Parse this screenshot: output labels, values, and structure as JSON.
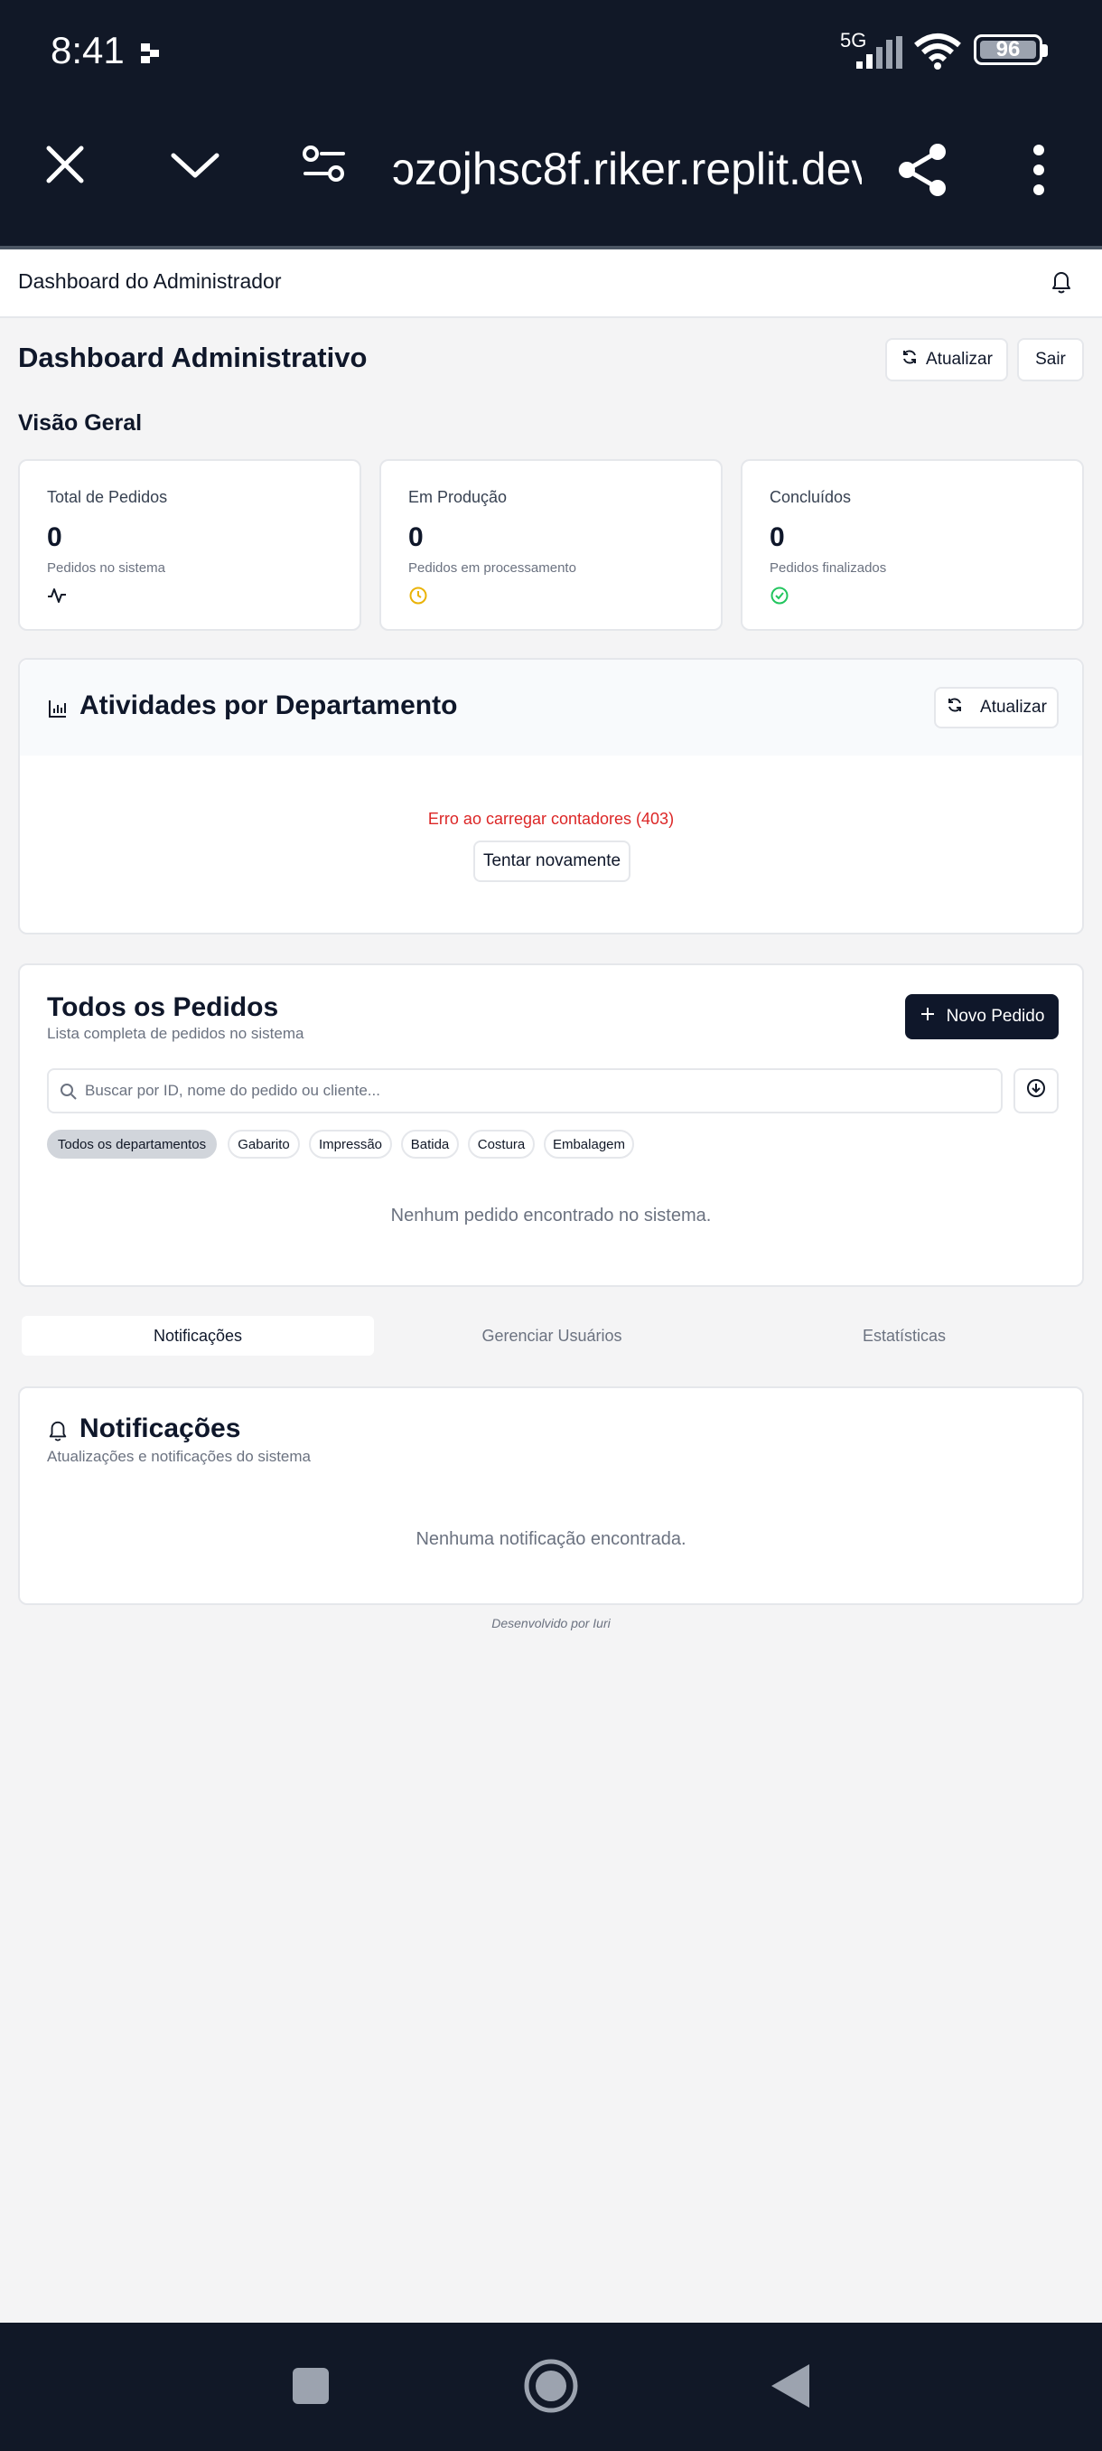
{
  "status_bar": {
    "time": "8:41",
    "network": "5G",
    "battery": "96",
    "icons": [
      "notification-icon",
      "signal-icon",
      "wifi-icon",
      "battery-icon"
    ]
  },
  "browser": {
    "url": "ɔzojhsc8f.riker.replit.dev",
    "icons": [
      "close-icon",
      "chevron-down-icon",
      "page-settings-icon",
      "share-icon",
      "more-icon"
    ]
  },
  "header": {
    "title": "Dashboard do Administrador"
  },
  "page": {
    "title": "Dashboard Administrativo",
    "refresh_label": "Atualizar",
    "logout_label": "Sair",
    "overview_label": "Visão Geral"
  },
  "stats": [
    {
      "label": "Total de Pedidos",
      "value": "0",
      "sub": "Pedidos no sistema",
      "icon": "activity-icon"
    },
    {
      "label": "Em Produção",
      "value": "0",
      "sub": "Pedidos em processamento",
      "icon": "clock-icon"
    },
    {
      "label": "Concluídos",
      "value": "0",
      "sub": "Pedidos finalizados",
      "icon": "check-circle-icon"
    }
  ],
  "departments": {
    "title": "Atividades por Departamento",
    "refresh_label": "Atualizar",
    "error": "Erro ao carregar contadores (403)",
    "retry_label": "Tentar novamente"
  },
  "orders": {
    "title": "Todos os Pedidos",
    "subtitle": "Lista completa de pedidos no sistema",
    "new_label": "Novo Pedido",
    "search_placeholder": "Buscar por ID, nome do pedido ou cliente...",
    "chips": [
      "Todos os departamentos",
      "Gabarito",
      "Impressão",
      "Batida",
      "Costura",
      "Embalagem"
    ],
    "empty": "Nenhum pedido encontrado no sistema."
  },
  "tabs": [
    "Notificações",
    "Gerenciar Usuários",
    "Estatísticas"
  ],
  "notifications": {
    "title": "Notificações",
    "subtitle": "Atualizações e notificações do sistema",
    "empty": "Nenhuma notificação encontrada."
  },
  "footer": "Desenvolvido por Iuri",
  "colors": {
    "primary": "#0f172a",
    "error": "#dc2626",
    "warning": "#eab308",
    "success": "#22c55e",
    "system_bar": "#111827"
  }
}
